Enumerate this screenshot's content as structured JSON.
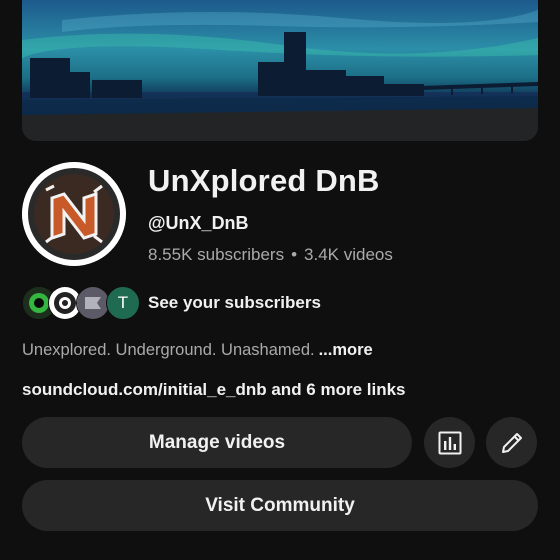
{
  "channel": {
    "name": "UnXplored DnB",
    "handle": "@UnX_DnB",
    "subscribers": "8.55K subscribers",
    "separator": "•",
    "videos": "3.4K videos"
  },
  "subscribers_row": {
    "avatars": [
      "subscriber-avatar-1",
      "subscriber-avatar-2",
      "subscriber-avatar-3",
      "T"
    ],
    "label": "See your subscribers"
  },
  "description": {
    "text": "Unexplored. Underground. Unashamed.",
    "more": "...more"
  },
  "links": {
    "text": "soundcloud.com/initial_e_dnb and 6 more links"
  },
  "actions": {
    "manage_videos": "Manage videos",
    "analytics_icon": "bar-chart-icon",
    "edit_icon": "pencil-icon",
    "visit_community": "Visit Community"
  },
  "colors": {
    "background": "#0f0f0f",
    "button_bg": "#272727",
    "text_primary": "#f1f1f1",
    "text_secondary": "#aaaaaa"
  }
}
